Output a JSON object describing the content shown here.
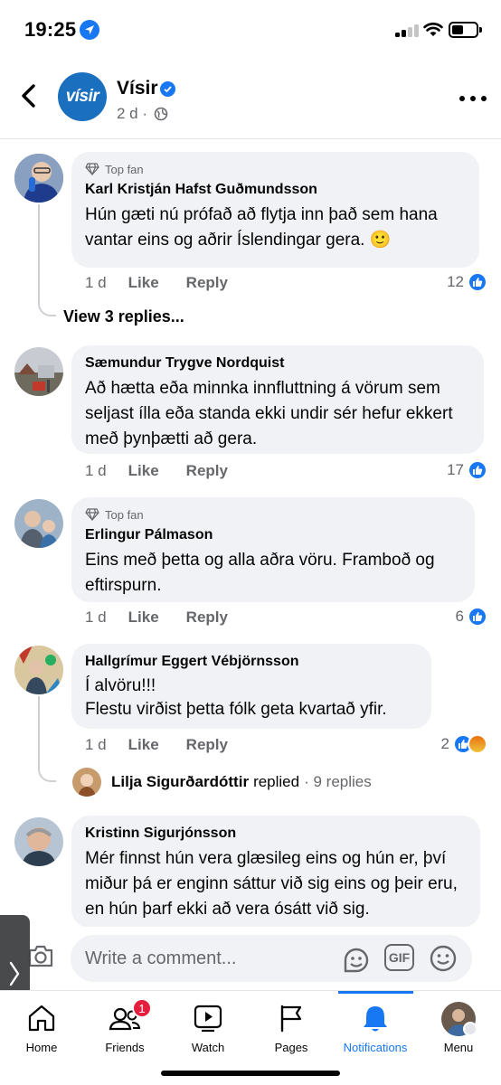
{
  "status_bar": {
    "time": "19:25"
  },
  "header": {
    "page_name": "Vísir",
    "logo_text": "vísir",
    "post_age": "2 d ·"
  },
  "comments": [
    {
      "badge": "Top fan",
      "author": "Karl Kristján Hafst Guðmundsson",
      "text": "Hún gæti nú prófað að flytja inn það sem hana vantar eins og aðrir Íslendingar gera. 🙂",
      "age": "1 d",
      "like": "Like",
      "reply": "Reply",
      "reactions": "12",
      "view_replies": "View 3 replies..."
    },
    {
      "author": "Sæmundur Trygve Nordquist",
      "text": "Að hætta eða minnka innfluttning á vörum sem seljast ílla eða standa ekki undir sér hefur ekkert með þynþætti að gera.",
      "age": "1 d",
      "like": "Like",
      "reply": "Reply",
      "reactions": "17"
    },
    {
      "badge": "Top fan",
      "author": "Erlingur Pálmason",
      "text": "Eins með þetta og alla aðra vöru. Framboð og eftirspurn.",
      "age": "1 d",
      "like": "Like",
      "reply": "Reply",
      "reactions": "6"
    },
    {
      "author": "Hallgrímur Eggert Vébjörnsson",
      "text": "Í alvöru!!!\nFlestu virðist þetta fólk geta kvartað yfir.",
      "age": "1 d",
      "like": "Like",
      "reply": "Reply",
      "reactions": "2",
      "reply_preview": {
        "name": "Lilja Sigurðardóttir",
        "action": "replied",
        "count": "· 9 replies"
      }
    },
    {
      "author": "Kristinn Sigurjónsson",
      "text": "Mér finnst hún vera glæsileg eins og hún er, því miður þá er enginn sáttur við sig eins og þeir eru, en hún þarf ekki að vera ósátt við sig."
    }
  ],
  "composer": {
    "placeholder": "Write a comment...",
    "gif_label": "GIF"
  },
  "nav": {
    "home": "Home",
    "friends": "Friends",
    "friends_badge": "1",
    "watch": "Watch",
    "pages": "Pages",
    "notifications": "Notifications",
    "menu": "Menu"
  },
  "colors": {
    "accent": "#1877f2",
    "bubble": "#f0f2f5",
    "secondary_text": "#65676b",
    "badge": "#e41e3f"
  }
}
